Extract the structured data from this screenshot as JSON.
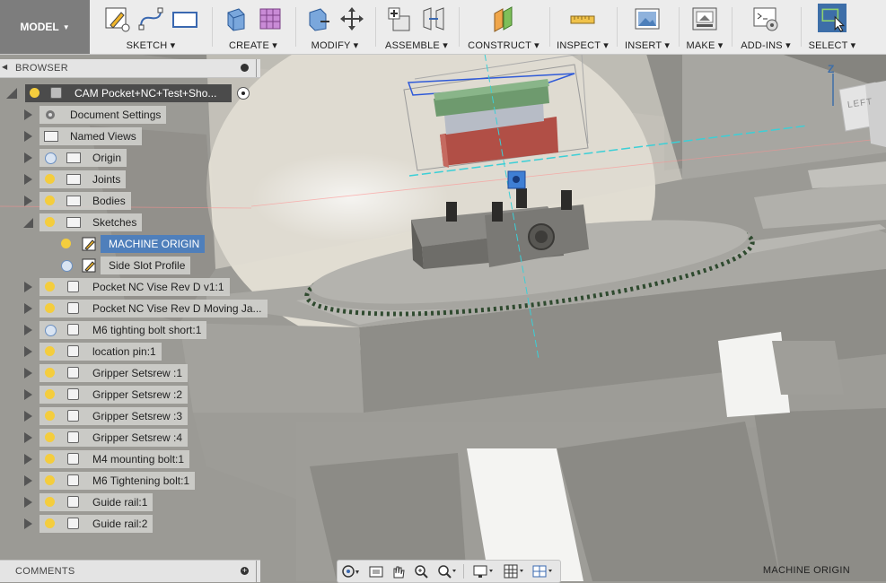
{
  "toolbar": {
    "workspace": "MODEL",
    "groups": [
      {
        "label": "SKETCH"
      },
      {
        "label": "CREATE"
      },
      {
        "label": "MODIFY"
      },
      {
        "label": "ASSEMBLE"
      },
      {
        "label": "CONSTRUCT"
      },
      {
        "label": "INSPECT"
      },
      {
        "label": "INSERT"
      },
      {
        "label": "MAKE"
      },
      {
        "label": "ADD-INS"
      },
      {
        "label": "SELECT"
      }
    ]
  },
  "browser": {
    "title": "BROWSER",
    "root": "CAM Pocket+NC+Test+Sho...",
    "items": [
      {
        "label": "Document Settings"
      },
      {
        "label": "Named Views"
      },
      {
        "label": "Origin"
      },
      {
        "label": "Joints"
      },
      {
        "label": "Bodies"
      },
      {
        "label": "Sketches"
      },
      {
        "label": "MACHINE ORIGIN"
      },
      {
        "label": "Side Slot Profile"
      },
      {
        "label": "Pocket NC Vise Rev D v1:1"
      },
      {
        "label": "Pocket NC Vise Rev D Moving Ja..."
      },
      {
        "label": "M6 tighting bolt short:1"
      },
      {
        "label": "location pin:1"
      },
      {
        "label": "Gripper Setsrew :1"
      },
      {
        "label": "Gripper Setsrew :2"
      },
      {
        "label": "Gripper Setsrew :3"
      },
      {
        "label": "Gripper Setsrew :4"
      },
      {
        "label": "M4 mounting bolt:1"
      },
      {
        "label": "M6 Tightening bolt:1"
      },
      {
        "label": "Guide rail:1"
      },
      {
        "label": "Guide rail:2"
      }
    ]
  },
  "comments": {
    "title": "COMMENTS"
  },
  "viewcube": {
    "axis": "Z",
    "face": "LEFT"
  },
  "status": {
    "selection": "MACHINE ORIGIN"
  },
  "colors": {
    "accent": "#3d6ea8",
    "selection": "#1e5fb4",
    "toolbar_bg": "#ececec"
  }
}
